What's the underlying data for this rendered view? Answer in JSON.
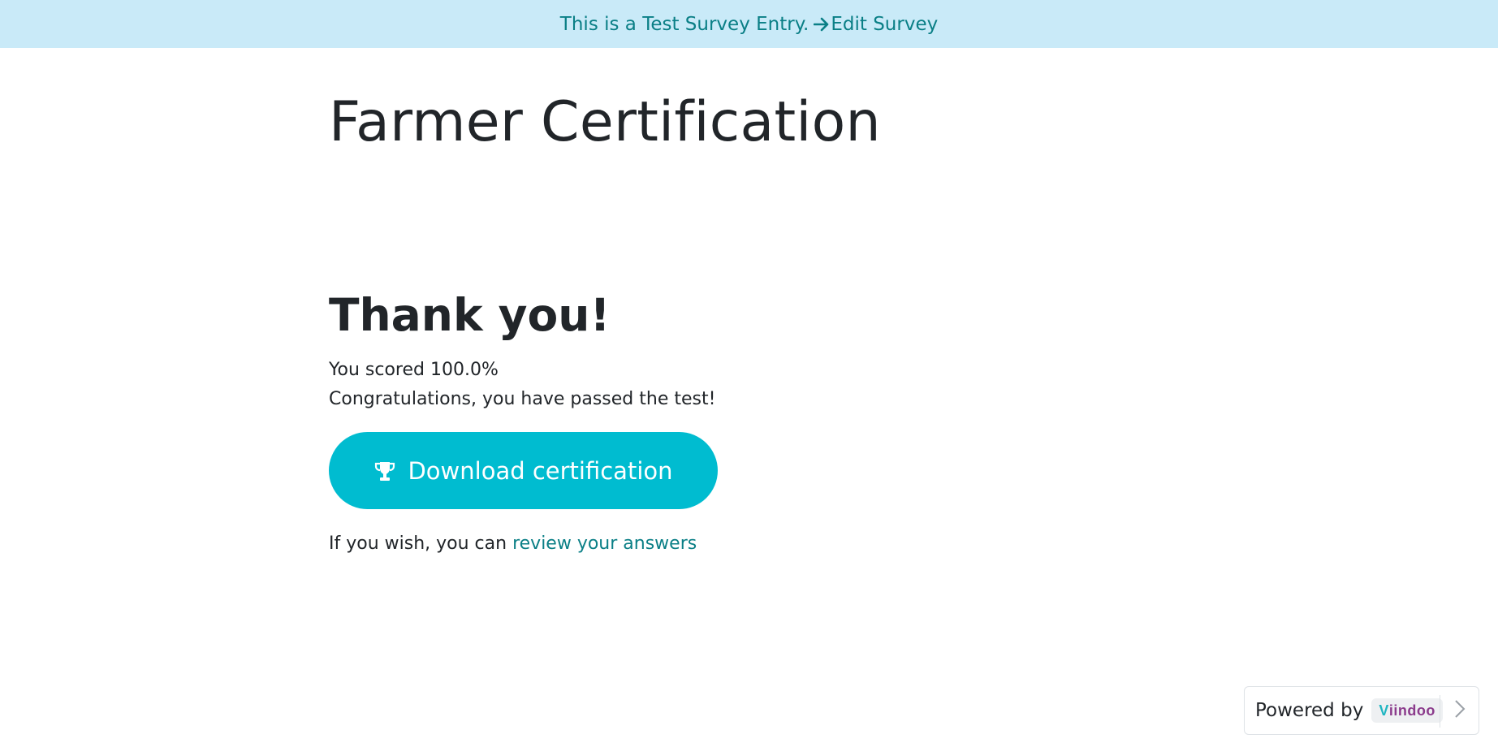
{
  "banner": {
    "message": "This is a Test Survey Entry.",
    "edit_link_label": "Edit Survey",
    "icon": "arrow-right-icon"
  },
  "survey": {
    "title": "Farmer Certification"
  },
  "result": {
    "heading": "Thank you!",
    "score_text": "You scored 100.0%",
    "congrats_text": "Congratulations, you have passed the test!",
    "download_button_label": "Download certification",
    "download_button_icon": "trophy-icon",
    "review_prefix": "If you wish, you can",
    "review_link_label": "review your answers"
  },
  "footer_badge": {
    "powered_by_label": "Powered by",
    "brand_first_letter": "V",
    "brand_rest": "iindoo",
    "chevron_icon": "chevron-right-icon"
  },
  "colors": {
    "banner_bg": "#c9eaf8",
    "banner_text": "#0a7f86",
    "button_bg": "#00bcd0",
    "link": "#0a7f86",
    "text": "#212529"
  }
}
